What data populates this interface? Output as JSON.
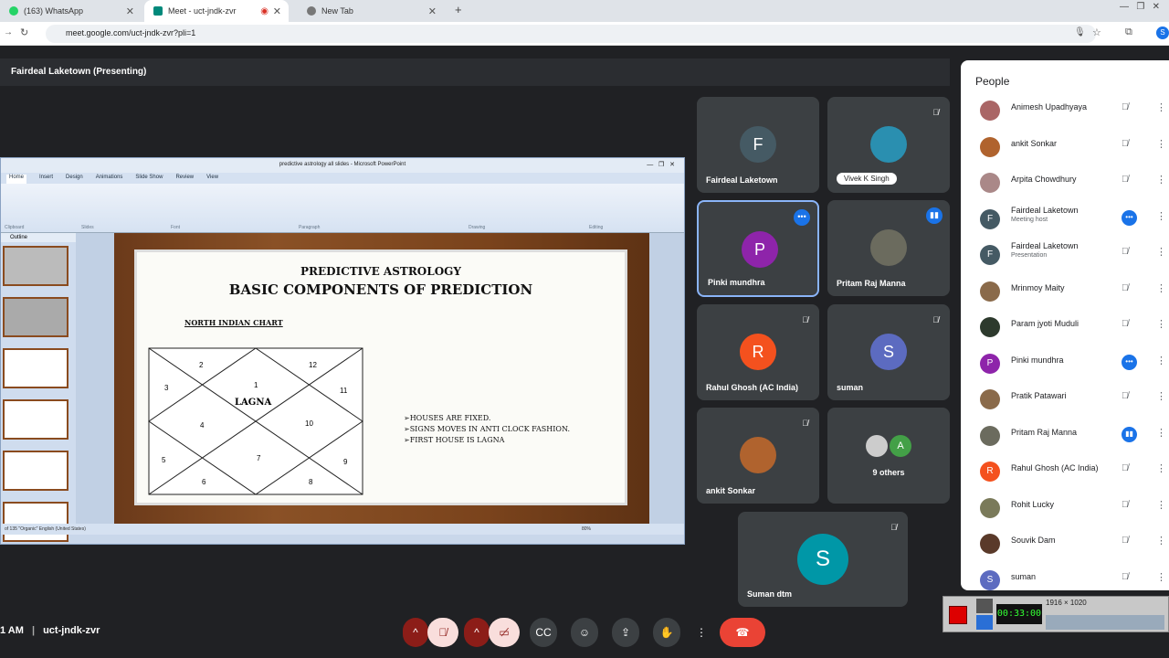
{
  "browser": {
    "tabs": [
      {
        "label": "(163) WhatsApp",
        "active": false
      },
      {
        "label": "Meet - uct-jndk-zvr",
        "active": true
      },
      {
        "label": "New Tab",
        "active": false
      }
    ],
    "url": "meet.google.com/uct-jndk-zvr?pli=1",
    "profile_initial": "S"
  },
  "meet": {
    "presenting_title": "Fairdeal Laketown (Presenting)",
    "meeting_code": "uct-jndk-zvr",
    "time_fragment": "1 AM"
  },
  "ppt": {
    "window_title": "predictive astrology all slides - Microsoft PowerPoint",
    "ribbon_tabs": [
      "Home",
      "Insert",
      "Design",
      "Animations",
      "Slide Show",
      "Review",
      "View"
    ],
    "ribbon_groups": [
      "Clipboard",
      "Slides",
      "Font",
      "Paragraph",
      "Drawing",
      "Editing"
    ],
    "outline_tab": "Outline",
    "status_text": "of 135   \"Organic\"   English (United States)",
    "zoom": "80%"
  },
  "slide": {
    "title1": "PREDICTIVE ASTROLOGY",
    "title2": "BASIC COMPONENTS OF PREDICTION",
    "subtitle": "NORTH INDIAN CHART",
    "center_label": "LAGNA",
    "house_numbers": [
      "2",
      "12",
      "3",
      "1",
      "11",
      "4",
      "10",
      "5",
      "7",
      "9",
      "6",
      "8"
    ],
    "bullets": [
      "➢HOUSES ARE FIXED.",
      "➢SIGNS MOVES IN ANTI CLOCK FASHION.",
      "➢FIRST HOUSE IS LAGNA"
    ]
  },
  "tiles": [
    {
      "name": "Fairdeal Laketown",
      "initial": "F",
      "color": "#455a64"
    },
    {
      "name": "Vivek K Singh",
      "initial": "",
      "color": "#2a8fb0"
    },
    {
      "name": "Pinki mundhra",
      "initial": "P",
      "color": "#8e24aa"
    },
    {
      "name": "Pritam Raj Manna",
      "initial": "",
      "color": "#6b6b5e"
    },
    {
      "name": "Rahul Ghosh (AC India)",
      "initial": "R",
      "color": "#f4511e"
    },
    {
      "name": "suman",
      "initial": "S",
      "color": "#5c6bc0"
    },
    {
      "name": "ankit Sonkar",
      "initial": "",
      "color": "#b0632e"
    },
    {
      "name": "9 others",
      "initial": "A",
      "color": "#43a047"
    },
    {
      "name": "Suman dtm",
      "initial": "S",
      "color": "#0097a7"
    }
  ],
  "people_panel": {
    "title": "People",
    "list": [
      {
        "name": "Animesh Upadhyaya",
        "role": "",
        "initial": "",
        "color": "#a66"
      },
      {
        "name": "ankit Sonkar",
        "role": "",
        "initial": "",
        "color": "#b0632e"
      },
      {
        "name": "Arpita Chowdhury",
        "role": "",
        "initial": "",
        "color": "#a88"
      },
      {
        "name": "Fairdeal Laketown",
        "role": "Meeting host",
        "initial": "F",
        "color": "#455a64"
      },
      {
        "name": "Fairdeal Laketown",
        "role": "Presentation",
        "initial": "F",
        "color": "#455a64"
      },
      {
        "name": "Mrinmoy Maity",
        "role": "",
        "initial": "",
        "color": "#8a6a4a"
      },
      {
        "name": "Param jyoti Muduli",
        "role": "",
        "initial": "",
        "color": "#2d3a2d"
      },
      {
        "name": "Pinki mundhra",
        "role": "",
        "initial": "P",
        "color": "#8e24aa"
      },
      {
        "name": "Pratik Patawari",
        "role": "",
        "initial": "",
        "color": "#8a6a4a"
      },
      {
        "name": "Pritam Raj Manna",
        "role": "",
        "initial": "",
        "color": "#6b6b5e"
      },
      {
        "name": "Rahul Ghosh (AC India)",
        "role": "",
        "initial": "R",
        "color": "#f4511e"
      },
      {
        "name": "Rohit Lucky",
        "role": "",
        "initial": "",
        "color": "#7a7a5a"
      },
      {
        "name": "Souvik Dam",
        "role": "",
        "initial": "",
        "color": "#5a3a2a"
      },
      {
        "name": "suman",
        "role": "",
        "initial": "S",
        "color": "#5c6bc0"
      }
    ]
  },
  "recorder": {
    "resolution": "1916 × 1020",
    "timer": "00:33:00"
  }
}
